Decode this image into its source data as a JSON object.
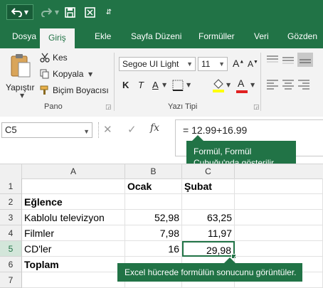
{
  "quick_access": {
    "more_glyph": "⇵"
  },
  "tabs": [
    {
      "label": "Dosya"
    },
    {
      "label": "Giriş"
    },
    {
      "label": "Ekle"
    },
    {
      "label": "Sayfa Düzeni"
    },
    {
      "label": "Formüller"
    },
    {
      "label": "Veri"
    },
    {
      "label": "Gözden"
    }
  ],
  "ribbon": {
    "paste_label": "Yapıştır",
    "cut_label": "Kes",
    "copy_label": "Kopyala",
    "format_painter_label": "Biçim Boyacısı",
    "clipboard_group": "Pano",
    "font_name": "Segoe UI Light",
    "font_size": "11",
    "bold": "K",
    "italic": "T",
    "underline": "A",
    "font_color_letter": "A",
    "font_group": "Yazı Tipi"
  },
  "formula_bar": {
    "name_box": "C5",
    "fx": "fx",
    "formula": "= 12.99+16.99"
  },
  "tooltips": {
    "formula_bar_tip_line1": "Formül, Formül",
    "formula_bar_tip_line2": "Çubuğu'nda gösterilir.",
    "cell_tip": "Excel hücrede formülün sonucunu görüntüler."
  },
  "sheet": {
    "columns": [
      "A",
      "B",
      "C"
    ],
    "rows": [
      {
        "num": "1",
        "a": "",
        "b": "Ocak",
        "c": "Şubat"
      },
      {
        "num": "2",
        "a": "Eğlence",
        "b": "",
        "c": ""
      },
      {
        "num": "3",
        "a": "Kablolu televizyon",
        "b": "52,98",
        "c": "63,25"
      },
      {
        "num": "4",
        "a": "Filmler",
        "b": "7,98",
        "c": "11,97"
      },
      {
        "num": "5",
        "a": "CD'ler",
        "b": "16",
        "c": "29,98"
      },
      {
        "num": "6",
        "a": "Toplam",
        "b": "",
        "c": ""
      },
      {
        "num": "7",
        "a": "",
        "b": "",
        "c": ""
      }
    ],
    "selected_cell": "C5"
  },
  "colors": {
    "excel_green": "#217346",
    "tooltip_green": "#217346"
  }
}
